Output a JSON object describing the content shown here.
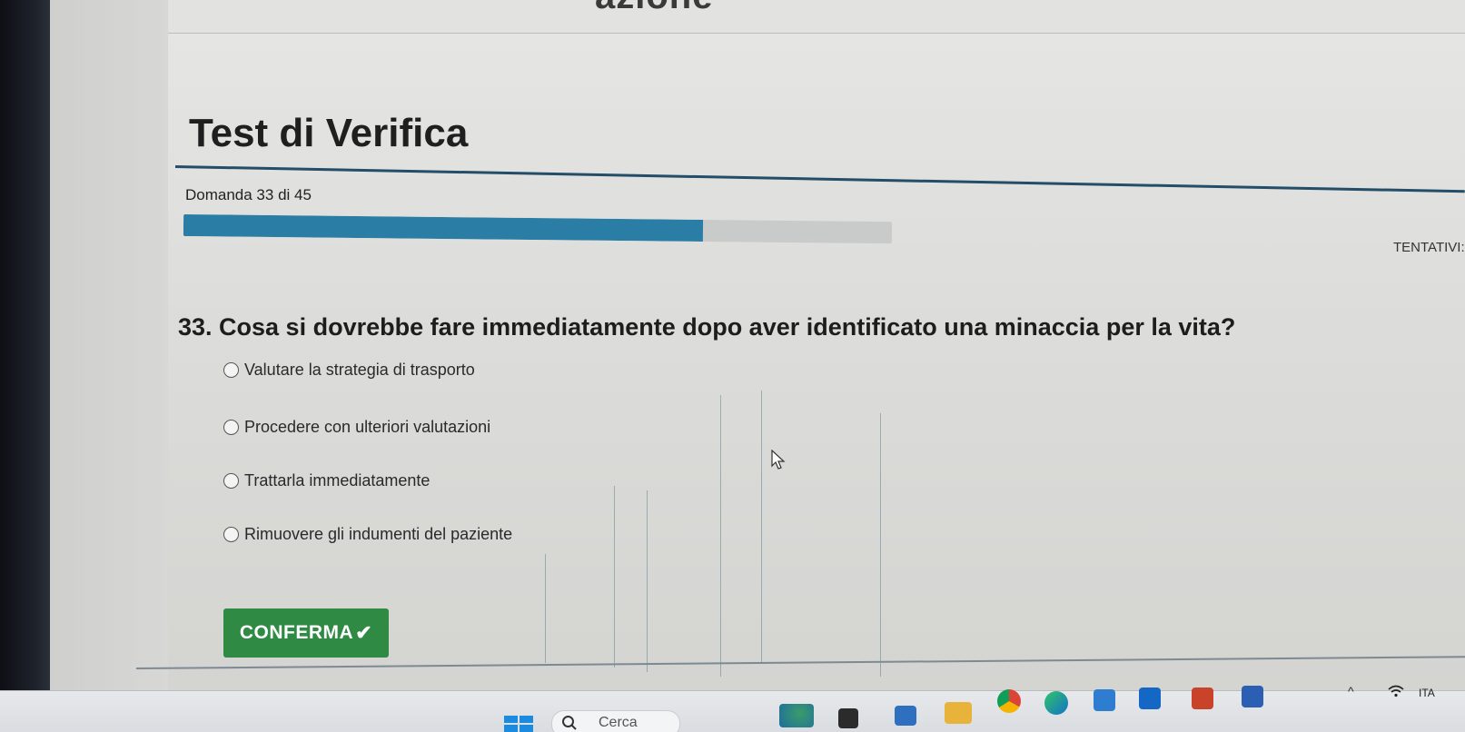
{
  "header": {
    "word_fragment": "azione"
  },
  "quiz": {
    "title": "Test di Verifica",
    "counter": "Domanda 33 di 45",
    "progress_fraction": 0.733,
    "attempts_label": "TENTATIVI:",
    "question": "33. Cosa si dovrebbe fare immediatamente dopo aver identificato una minaccia per la vita?",
    "options": [
      {
        "label": "Valutare la strategia di trasporto"
      },
      {
        "label": "Procedere con ulteriori valutazioni"
      },
      {
        "label": "Trattarla immediatamente"
      },
      {
        "label": "Rimuovere gli indumenti del paziente"
      }
    ],
    "confirm_label": "CONFERMA"
  },
  "taskbar": {
    "search_placeholder": "Cerca",
    "language": "ITA",
    "icons": [
      "start-icon",
      "search-icon",
      "weather-icon",
      "task-view-icon",
      "meet-icon",
      "file-explorer-icon",
      "chrome-icon",
      "edge-icon",
      "store-icon",
      "outlook-icon",
      "powerpoint-icon",
      "word-icon",
      "chevron-up-icon",
      "wifi-icon"
    ]
  },
  "colors": {
    "accent": "#2a7ea6",
    "confirm_button": "#2f8a43",
    "rule": "#234d68"
  }
}
